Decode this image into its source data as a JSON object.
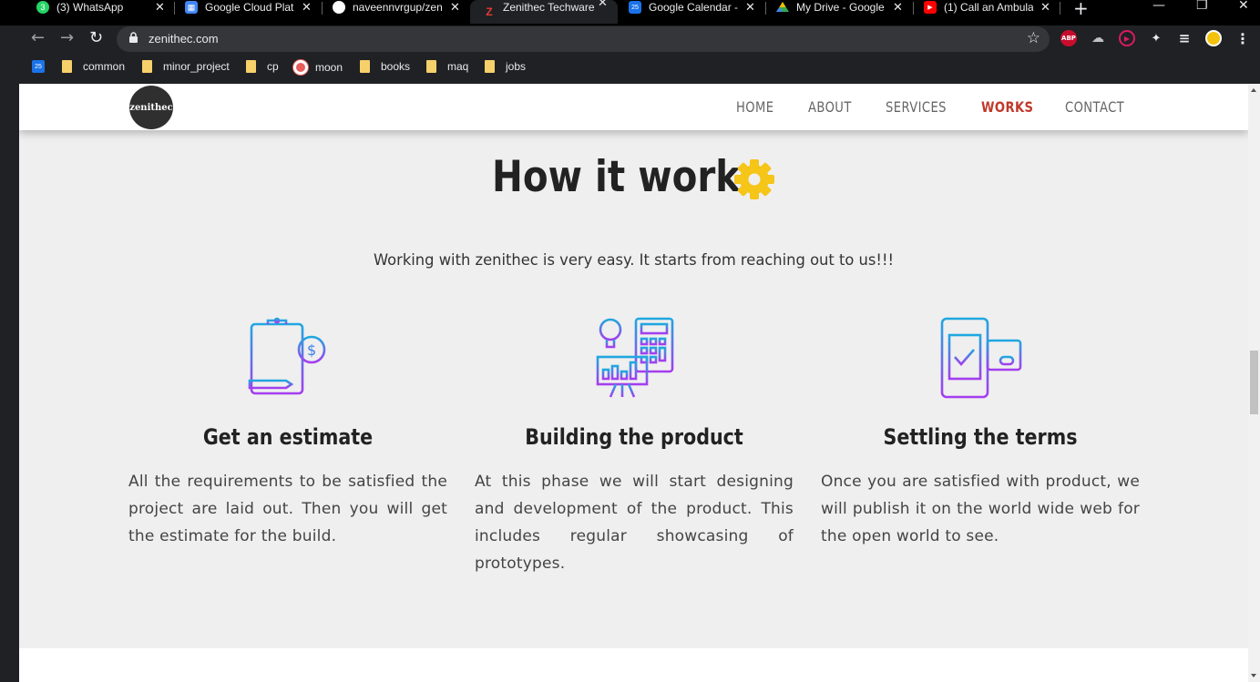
{
  "browser": {
    "tabs": [
      {
        "title": "(3) WhatsApp",
        "icon": "whatsapp-icon",
        "color": "#25d366",
        "glyph": "3"
      },
      {
        "title": "Google Cloud Plat",
        "icon": "cloud-chip-icon",
        "color": "#4285f4",
        "glyph": "▦"
      },
      {
        "title": "naveennvrgup/zen",
        "icon": "github-icon",
        "color": "#ffffff",
        "glyph": "●"
      },
      {
        "title": "Zenithec Techware",
        "icon": "zenithec-favicon",
        "color": "#e53935",
        "glyph": "Z"
      },
      {
        "title": "Google Calendar -",
        "icon": "calendar-icon",
        "color": "#1a73e8",
        "glyph": "25"
      },
      {
        "title": "My Drive - Google",
        "icon": "drive-icon",
        "color": "#34a853",
        "glyph": "▲"
      },
      {
        "title": "(1) Call an Ambula",
        "icon": "youtube-icon",
        "color": "#ff0000",
        "glyph": "▶"
      }
    ],
    "new_tab": "+",
    "window_controls": {
      "minimize": "—",
      "restore": "❐",
      "close": "✕"
    },
    "back": "←",
    "forward": "→",
    "reload": "↻",
    "url": "zenithec.com",
    "star": "☆",
    "extensions": [
      {
        "name": "adblock-icon",
        "label": "ABP",
        "color": "#c70d2c"
      },
      {
        "name": "cloud-extension-icon",
        "label": "☁",
        "color": "#202124"
      },
      {
        "name": "record-extension-icon",
        "label": "▶",
        "color": "#d81b60"
      },
      {
        "name": "puzzle-extensions-icon",
        "label": "✦",
        "color": "#202124"
      },
      {
        "name": "media-queue-icon",
        "label": "≡",
        "color": "#202124"
      },
      {
        "name": "profile-avatar",
        "label": "",
        "color": "#f4c20d"
      },
      {
        "name": "menu-kebab-icon",
        "label": "⋮",
        "color": "#202124"
      }
    ],
    "bookmarks": [
      {
        "label": "",
        "icon": "calendar-bookmark-icon",
        "type": "calendar"
      },
      {
        "label": "common",
        "icon": "folder-icon",
        "type": "folder"
      },
      {
        "label": "minor_project",
        "icon": "folder-icon",
        "type": "folder"
      },
      {
        "label": "cp",
        "icon": "folder-icon",
        "type": "folder"
      },
      {
        "label": "moon",
        "icon": "moon-bookmark-icon",
        "type": "site"
      },
      {
        "label": "books",
        "icon": "folder-icon",
        "type": "folder"
      },
      {
        "label": "maq",
        "icon": "folder-icon",
        "type": "folder"
      },
      {
        "label": "jobs",
        "icon": "folder-icon",
        "type": "folder"
      }
    ]
  },
  "site": {
    "logo_text": "zenithec",
    "nav": [
      {
        "label": "HOME",
        "active": false
      },
      {
        "label": "ABOUT",
        "active": false
      },
      {
        "label": "SERVICES",
        "active": false
      },
      {
        "label": "WORKS",
        "active": true
      },
      {
        "label": "CONTACT",
        "active": false
      }
    ],
    "accent_color": "#c0392b",
    "gear_color": "#f5c518",
    "section_title": "How it works",
    "intro": "Working with zenithec is very easy. It starts from reaching out to us!!!",
    "steps": [
      {
        "title": "Get an estimate",
        "icon": "clipboard-estimate-icon",
        "text": "All the requirements to be satisfied the project are laid out. Then you will get the estimate for the build."
      },
      {
        "title": "Building the product",
        "icon": "build-presentation-icon",
        "text": "At this phase we will start designing and development of the product. This includes regular showcasing of prototypes."
      },
      {
        "title": "Settling the terms",
        "icon": "phone-payment-icon",
        "text": "Once you are satisfied with product, we will publish it on the world wide web for the open world to see."
      }
    ]
  }
}
